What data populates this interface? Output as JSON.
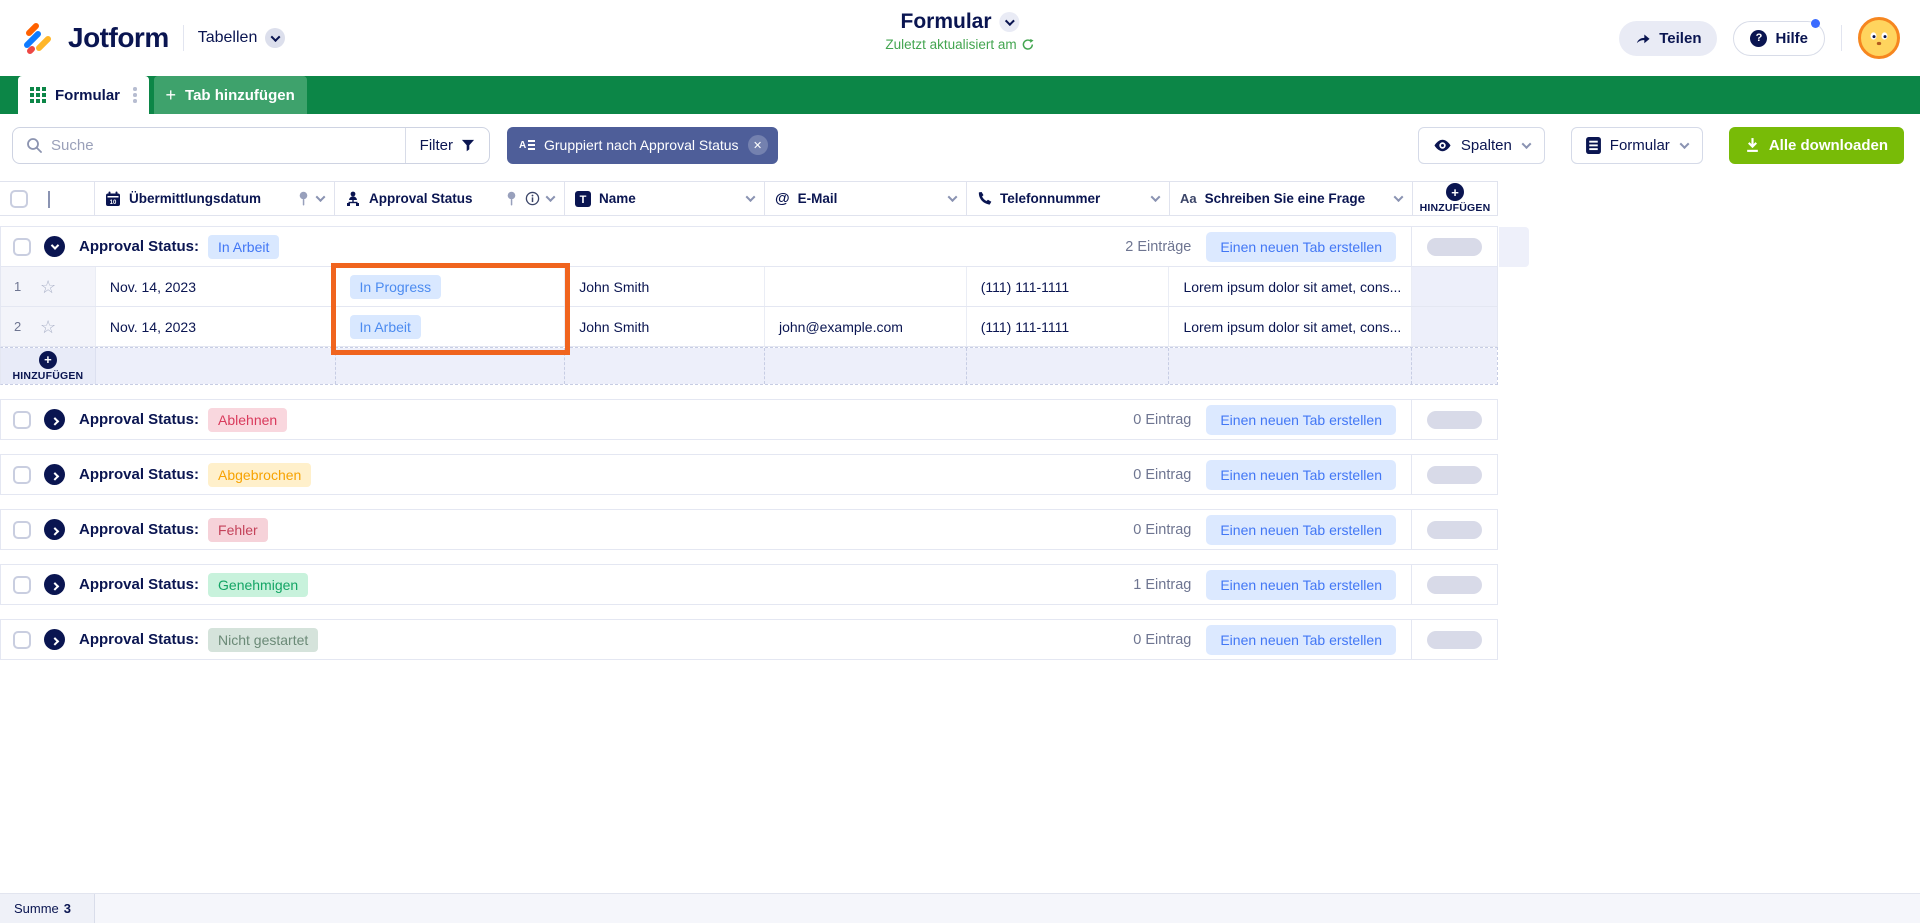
{
  "colors": {
    "navy": "#0A1551",
    "tabbar_green": "#0C8647",
    "download_green": "#78BB07",
    "group_chip_bg": "#4E5E99",
    "highlight_orange": "#F0641E",
    "link_blue": "#4277F5"
  },
  "header": {
    "brand": "Jotform",
    "product": "Tabellen",
    "title": "Formular",
    "subtitle": "Zuletzt aktualisiert am",
    "share_label": "Teilen",
    "help_label": "Hilfe"
  },
  "tabbar": {
    "active_tab": "Formular",
    "add_tab_label": "Tab hinzufügen"
  },
  "toolbar": {
    "search_placeholder": "Suche",
    "filter_label": "Filter",
    "group_chip_label": "Gruppiert nach Approval Status",
    "columns_label": "Spalten",
    "form_label": "Formular",
    "download_label": "Alle downloaden"
  },
  "table": {
    "columns": [
      {
        "label": "Übermittlungsdatum"
      },
      {
        "label": "Approval Status"
      },
      {
        "label": "Name"
      },
      {
        "label": "E-Mail"
      },
      {
        "label": "Telefonnummer"
      },
      {
        "label": "Schreiben Sie eine Frage"
      }
    ],
    "add_column_label": "HINZUFÜGEN",
    "add_row_label": "HINZUFÜGEN"
  },
  "groups": [
    {
      "label": "Approval Status:",
      "badge": "In Arbeit",
      "badge_bg": "#D9E8FF",
      "badge_color": "#4277F5",
      "count": "2 Einträge",
      "action": "Einen neuen Tab erstellen"
    },
    {
      "label": "Approval Status:",
      "badge": "Ablehnen",
      "badge_bg": "#F9D7DE",
      "badge_color": "#D93A5C",
      "count": "0 Eintrag",
      "action": "Einen neuen Tab erstellen"
    },
    {
      "label": "Approval Status:",
      "badge": "Abgebrochen",
      "badge_bg": "#FFF0CB",
      "badge_color": "#F7A302",
      "count": "0 Eintrag",
      "action": "Einen neuen Tab erstellen"
    },
    {
      "label": "Approval Status:",
      "badge": "Fehler",
      "badge_bg": "#F6D2D9",
      "badge_color": "#C4425A",
      "count": "0 Eintrag",
      "action": "Einen neuen Tab erstellen"
    },
    {
      "label": "Approval Status:",
      "badge": "Genehmigen",
      "badge_bg": "#C8F2DC",
      "badge_color": "#14A565",
      "count": "1 Eintrag",
      "action": "Einen neuen Tab erstellen"
    },
    {
      "label": "Approval Status:",
      "badge": "Nicht gestartet",
      "badge_bg": "#D5E3DB",
      "badge_color": "#6B8A77",
      "count": "0 Eintrag",
      "action": "Einen neuen Tab erstellen"
    }
  ],
  "rows": [
    {
      "num": "1",
      "date": "Nov. 14, 2023",
      "status": "In Progress",
      "status_bg": "#D9E8FF",
      "status_color": "#4C8BF0",
      "name": "John Smith",
      "email": "",
      "phone": "(111) 111-1111",
      "question": "Lorem ipsum dolor sit amet, cons..."
    },
    {
      "num": "2",
      "date": "Nov. 14, 2023",
      "status": "In Arbeit",
      "status_bg": "#D9E8FF",
      "status_color": "#4C8BF0",
      "name": "John Smith",
      "email": "john@example.com",
      "phone": "(111) 111-1111",
      "question": "Lorem ipsum dolor sit amet, cons..."
    }
  ],
  "footer": {
    "sum_label": "Summe",
    "sum_value": "3"
  }
}
